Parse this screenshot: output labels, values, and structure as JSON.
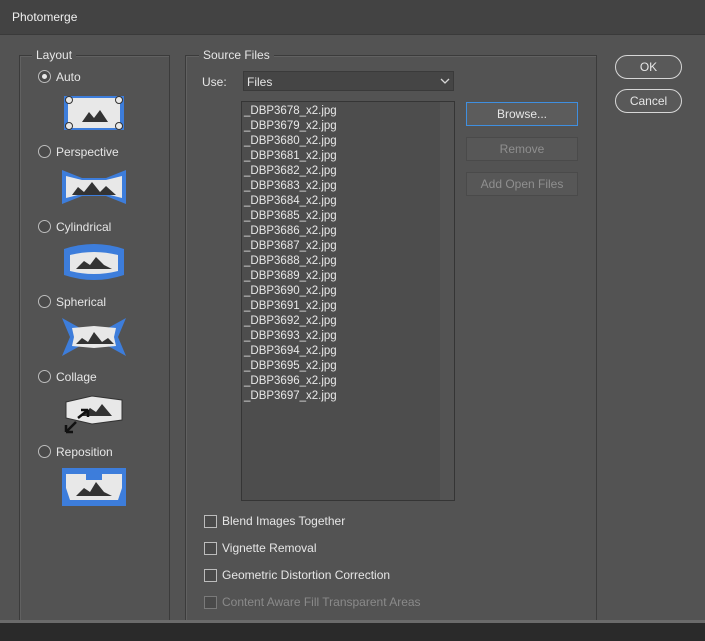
{
  "window": {
    "title": "Photomerge"
  },
  "layout": {
    "legend": "Layout",
    "options": [
      {
        "label": "Auto",
        "checked": true
      },
      {
        "label": "Perspective",
        "checked": false
      },
      {
        "label": "Cylindrical",
        "checked": false
      },
      {
        "label": "Spherical",
        "checked": false
      },
      {
        "label": "Collage",
        "checked": false
      },
      {
        "label": "Reposition",
        "checked": false
      }
    ]
  },
  "source": {
    "legend": "Source Files",
    "use_label": "Use:",
    "use_value": "Files",
    "files": [
      "_DBP3678_x2.jpg",
      "_DBP3679_x2.jpg",
      "_DBP3680_x2.jpg",
      "_DBP3681_x2.jpg",
      "_DBP3682_x2.jpg",
      "_DBP3683_x2.jpg",
      "_DBP3684_x2.jpg",
      "_DBP3685_x2.jpg",
      "_DBP3686_x2.jpg",
      "_DBP3687_x2.jpg",
      "_DBP3688_x2.jpg",
      "_DBP3689_x2.jpg",
      "_DBP3690_x2.jpg",
      "_DBP3691_x2.jpg",
      "_DBP3692_x2.jpg",
      "_DBP3693_x2.jpg",
      "_DBP3694_x2.jpg",
      "_DBP3695_x2.jpg",
      "_DBP3696_x2.jpg",
      "_DBP3697_x2.jpg"
    ],
    "browse_label": "Browse...",
    "remove_label": "Remove",
    "add_open_files_label": "Add Open Files"
  },
  "options": {
    "blend": {
      "label": "Blend Images Together",
      "checked": false
    },
    "vignette": {
      "label": "Vignette Removal",
      "checked": false
    },
    "geometric": {
      "label": "Geometric Distortion Correction",
      "checked": false
    },
    "content_aware": {
      "label": "Content Aware Fill Transparent Areas",
      "checked": false,
      "disabled": true
    }
  },
  "buttons": {
    "ok": "OK",
    "cancel": "Cancel"
  },
  "colors": {
    "accent_blue": "#3d7ddb",
    "dialog_bg": "#535353"
  }
}
